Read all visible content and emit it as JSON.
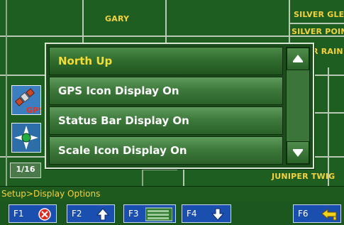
{
  "map": {
    "streets": [
      "GARY",
      "SILVER GLE",
      "SILVER POIN",
      "R RAIN",
      "JUNIPER TWIG"
    ]
  },
  "side_tools": {
    "gps_label": "GPS",
    "scale_label": "1/16"
  },
  "menu": {
    "items": [
      {
        "label": "North Up",
        "selected": true
      },
      {
        "label": "GPS Icon Display On",
        "selected": false
      },
      {
        "label": "Status Bar Display On",
        "selected": false
      },
      {
        "label": "Scale Icon Display On",
        "selected": false
      }
    ]
  },
  "breadcrumb": "Setup>Display Options",
  "function_keys": [
    {
      "label": "F1",
      "icon": "cancel-icon"
    },
    {
      "label": "F2",
      "icon": "arrow-up-icon"
    },
    {
      "label": "F3",
      "icon": "menu-list-icon"
    },
    {
      "label": "F4",
      "icon": "arrow-down-icon"
    },
    {
      "label": "F6",
      "icon": "back-icon"
    }
  ],
  "colors": {
    "map_green": "#1f5e21",
    "street_label": "#f4d23b",
    "selected_text": "#f7dc33",
    "fkey_blue": "#1a4fb0"
  }
}
